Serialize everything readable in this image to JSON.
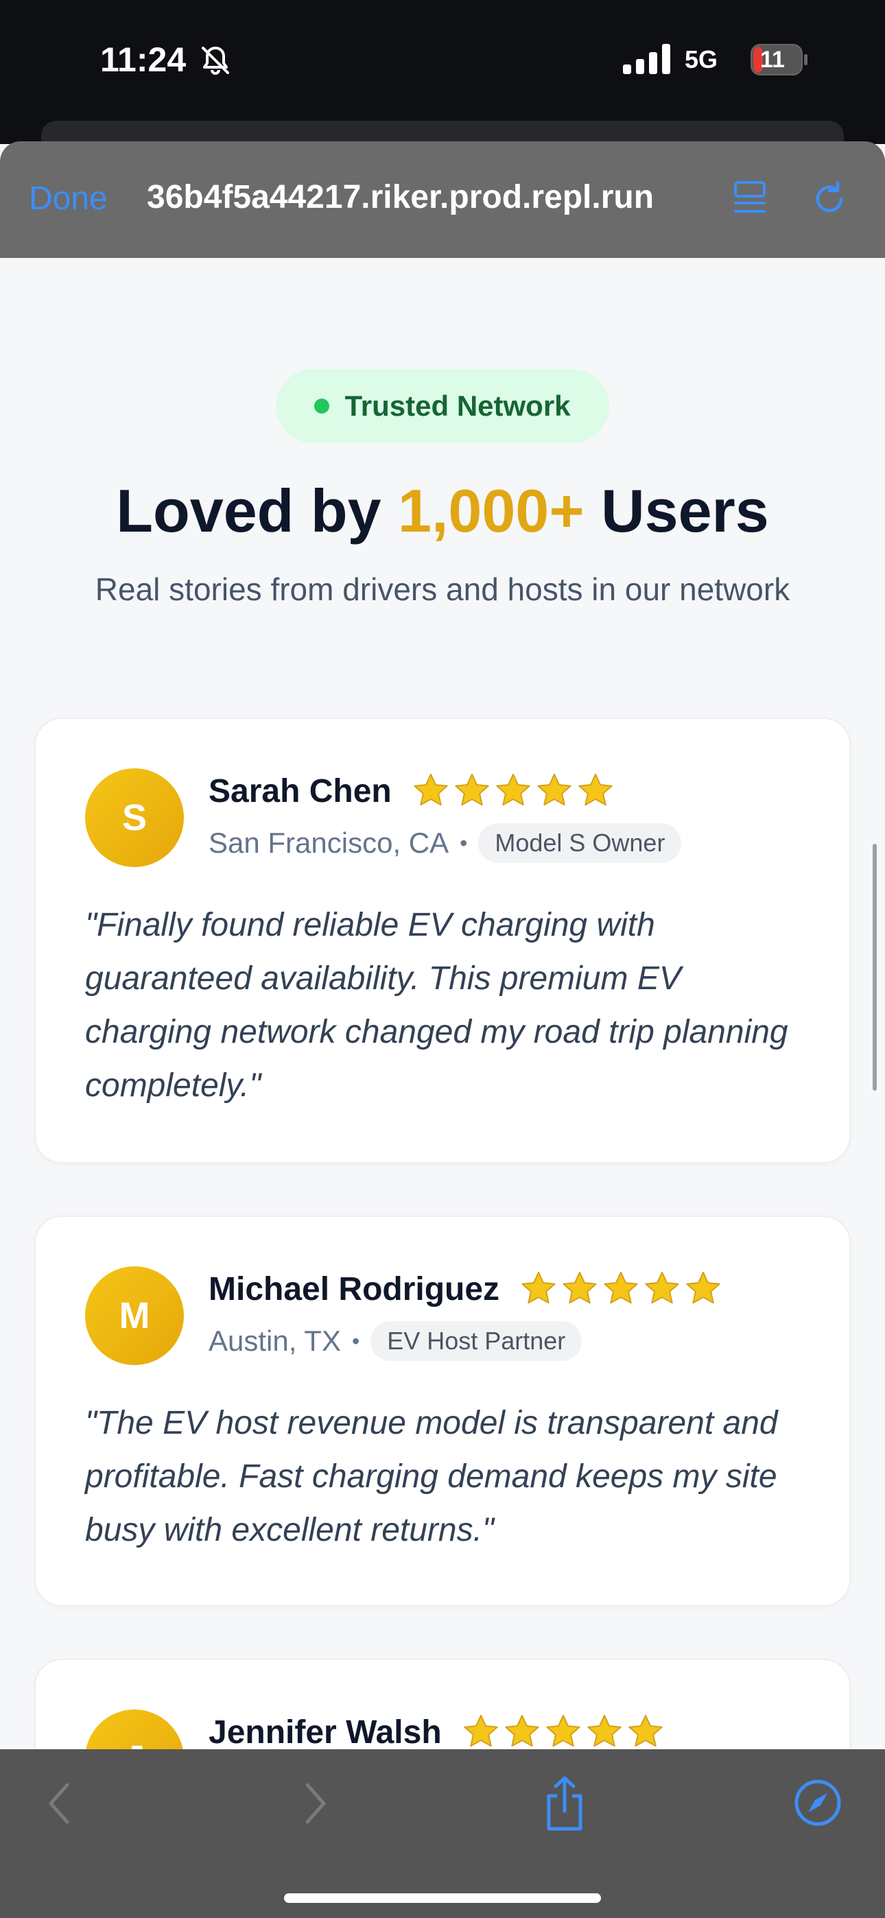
{
  "status_bar": {
    "time": "11:24",
    "network": "5G",
    "battery": "11",
    "icons": [
      "bell-slash-icon",
      "signal-icon",
      "battery-icon"
    ]
  },
  "browser": {
    "done_label": "Done",
    "url": "36b4f5a44217.riker.prod.repl.run",
    "icons": [
      "reader-icon",
      "reload-icon"
    ]
  },
  "section": {
    "badge": "Trusted Network",
    "headline_prefix": "Loved by ",
    "headline_accent": "1,000+",
    "headline_suffix": " Users",
    "subhead": "Real stories from drivers and hosts in our network",
    "accent_color": "#e0a614"
  },
  "testimonials": [
    {
      "initial": "S",
      "name": "Sarah Chen",
      "rating": 5,
      "location": "San Francisco, CA",
      "separator": "•",
      "role": "Model S Owner",
      "quote": "\"Finally found reliable EV charging with guaranteed availability. This premium EV charging network changed my road trip planning completely.\""
    },
    {
      "initial": "M",
      "name": "Michael Rodriguez",
      "rating": 5,
      "location": "Austin, TX",
      "separator": "•",
      "role": "EV Host Partner",
      "quote": "\"The EV host revenue model is transparent and profitable. Fast charging demand keeps my site busy with excellent returns.\""
    },
    {
      "initial": "J",
      "name": "Jennifer Walsh",
      "rating": 5
    }
  ],
  "toolbar": {
    "icons": [
      "back-icon",
      "forward-icon",
      "share-icon",
      "compass-icon"
    ]
  },
  "colors": {
    "link_blue": "#3d8ef5",
    "badge_green": "#22c55e",
    "star_gold": "#f5c518"
  }
}
